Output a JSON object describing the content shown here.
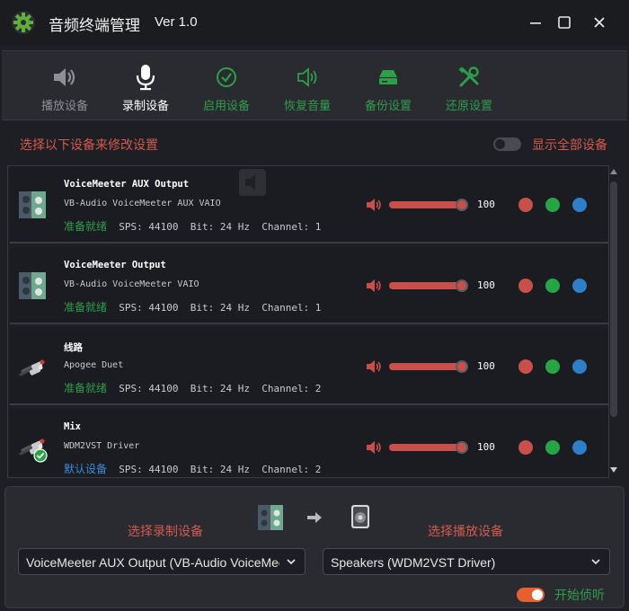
{
  "app": {
    "title": "音频终端管理",
    "version": "Ver 1.0"
  },
  "toolbar": [
    {
      "label": "播放设备",
      "icon": "speaker-icon"
    },
    {
      "label": "录制设备",
      "icon": "microphone-icon"
    },
    {
      "label": "启用设备",
      "icon": "check-circle-icon"
    },
    {
      "label": "恢复音量",
      "icon": "volume-icon"
    },
    {
      "label": "备份设置",
      "icon": "backup-drive-icon"
    },
    {
      "label": "还原设置",
      "icon": "tools-icon"
    }
  ],
  "hint": "选择以下设备来修改设置",
  "show_all": {
    "label": "显示全部设备",
    "on": false
  },
  "devices": [
    {
      "name": "VoiceMeeter AUX Output",
      "driver": "VB-Audio VoiceMeeter AUX VAIO",
      "status": "准备就绪",
      "status_type": "ready",
      "details": "  SPS: 44100  Bit: 24 Hz  Channel: 1",
      "volume": "100",
      "icon": "voicemeeter-icon"
    },
    {
      "name": "VoiceMeeter Output",
      "driver": "VB-Audio VoiceMeeter VAIO",
      "status": "准备就绪",
      "status_type": "ready",
      "details": "  SPS: 44100  Bit: 24 Hz  Channel: 1",
      "volume": "100",
      "icon": "voicemeeter-icon"
    },
    {
      "name": "线路",
      "driver": "Apogee Duet",
      "status": "准备就绪",
      "status_type": "ready",
      "details": "  SPS: 44100  Bit: 24 Hz  Channel: 2",
      "volume": "100",
      "icon": "rca-cable-icon"
    },
    {
      "name": "Mix",
      "driver": "WDM2VST Driver",
      "status": "默认设备",
      "status_type": "default",
      "details": "  SPS: 44100  Bit: 24 Hz  Channel: 2",
      "volume": "100",
      "icon": "rca-cable-default-icon"
    }
  ],
  "bottom": {
    "record_label": "选择录制设备",
    "play_label": "选择播放设备",
    "record_value": "VoiceMeeter AUX Output (VB-Audio VoiceMeeter AUX VAIO)",
    "play_value": "Speakers (WDM2VST Driver)",
    "listen_label": "开始侦听",
    "listen_on": true
  },
  "colors": {
    "accent_red": "#c9504a",
    "accent_green": "#27a544",
    "accent_blue": "#2f7ec8",
    "toggle_on": "#e4612f"
  }
}
